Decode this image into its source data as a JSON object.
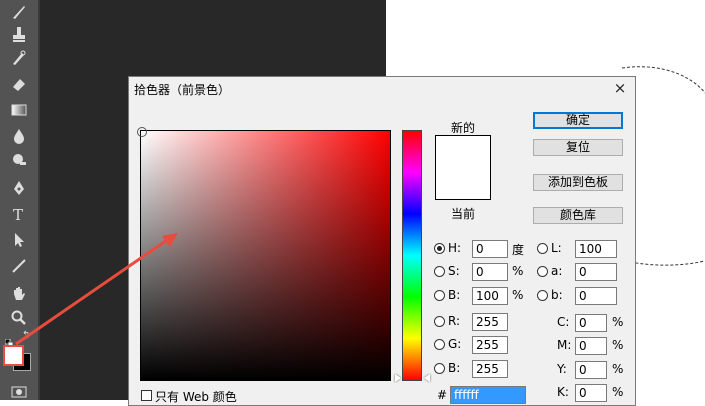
{
  "toolbar": {
    "tools": [
      "brush-icon",
      "stamp-icon",
      "history-brush-icon",
      "eraser-icon",
      "gradient-icon",
      "blur-icon",
      "dodge-icon",
      "pen-icon",
      "type-icon",
      "path-select-icon",
      "line-icon",
      "hand-icon",
      "zoom-icon"
    ]
  },
  "colors": {
    "foreground": "#ffffff",
    "background": "#000000",
    "accent": "#e74c3c"
  },
  "dialog": {
    "title": "拾色器（前景色）",
    "close": "×",
    "new_label": "新的",
    "current_label": "当前",
    "buttons": {
      "ok": "确定",
      "reset": "复位",
      "add_swatch": "添加到色板",
      "libraries": "颜色库"
    },
    "fields": {
      "H": {
        "label": "H:",
        "value": "0",
        "unit": "度"
      },
      "S": {
        "label": "S:",
        "value": "0",
        "unit": "%"
      },
      "B": {
        "label": "B:",
        "value": "100",
        "unit": "%"
      },
      "R": {
        "label": "R:",
        "value": "255"
      },
      "G": {
        "label": "G:",
        "value": "255"
      },
      "Bv": {
        "label": "B:",
        "value": "255"
      },
      "L": {
        "label": "L:",
        "value": "100"
      },
      "a": {
        "label": "a:",
        "value": "0"
      },
      "b": {
        "label": "b:",
        "value": "0"
      },
      "C": {
        "label": "C:",
        "value": "0",
        "unit": "%"
      },
      "M": {
        "label": "M:",
        "value": "0",
        "unit": "%"
      },
      "Y": {
        "label": "Y:",
        "value": "0",
        "unit": "%"
      },
      "K": {
        "label": "K:",
        "value": "0",
        "unit": "%"
      },
      "hex": {
        "label": "#",
        "value": "ffffff"
      }
    },
    "web_only": "只有 Web 颜色"
  }
}
